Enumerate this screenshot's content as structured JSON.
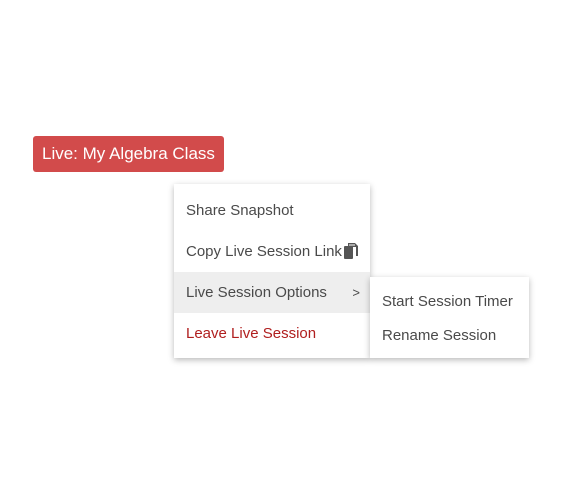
{
  "session_badge": {
    "label": "Live: My Algebra Class",
    "color": "#d24b4b"
  },
  "menu": {
    "items": [
      {
        "label": "Share Snapshot"
      },
      {
        "label": "Copy Live Session Link",
        "icon": "copy-icon"
      },
      {
        "label": "Live Session Options",
        "submenu_indicator": ">"
      },
      {
        "label": "Leave Live Session",
        "color": "#b01e1e"
      }
    ]
  },
  "submenu": {
    "items": [
      {
        "label": "Start Session Timer"
      },
      {
        "label": "Rename Session"
      }
    ]
  }
}
